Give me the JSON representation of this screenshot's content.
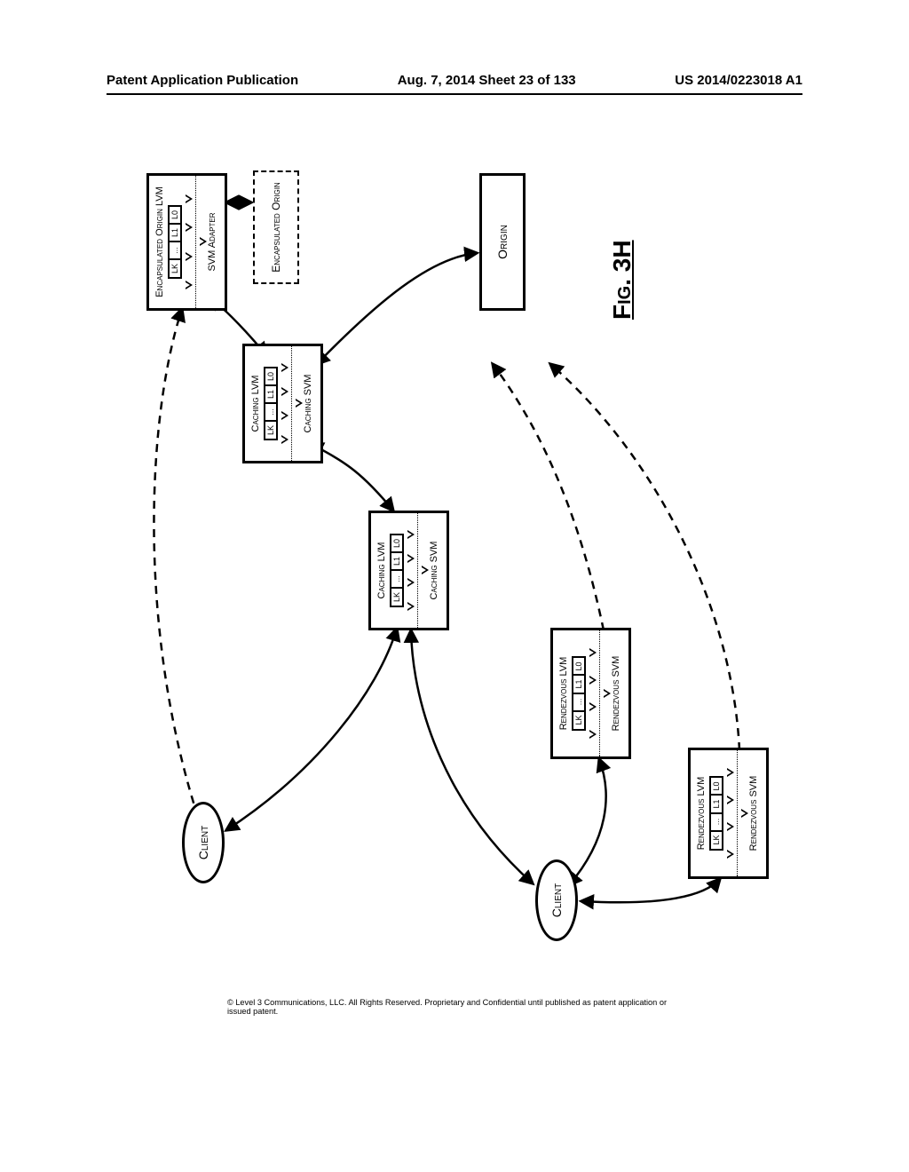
{
  "header": {
    "left": "Patent Application Publication",
    "middle": "Aug. 7, 2014  Sheet 23 of 133",
    "right": "US 2014/0223018 A1"
  },
  "copyright": "© Level 3 Communications, LLC.  All Rights Reserved.  Proprietary and Confidential until published as patent application or issued patent.",
  "figure_label": "Fig. 3H",
  "clients": {
    "a": "Client",
    "b": "Client"
  },
  "origin": "Origin",
  "encapsulated_origin": "Encapsulated Origin",
  "nodes": {
    "enc_origin_lvm": {
      "title": "Encapsulated Origin LVM",
      "svm": "SVM Adapter"
    },
    "caching_a": {
      "title": "Caching LVM",
      "svm": "Caching SVM"
    },
    "caching_b": {
      "title": "Caching LVM",
      "svm": "Caching SVM"
    },
    "rendezvous_a": {
      "title": "Rendezvous LVM",
      "svm": "Rendezvous SVM"
    },
    "rendezvous_b": {
      "title": "Rendezvous LVM",
      "svm": "Rendezvous SVM"
    }
  },
  "layer_cells": [
    "LK",
    "...",
    "L1",
    "L0"
  ]
}
